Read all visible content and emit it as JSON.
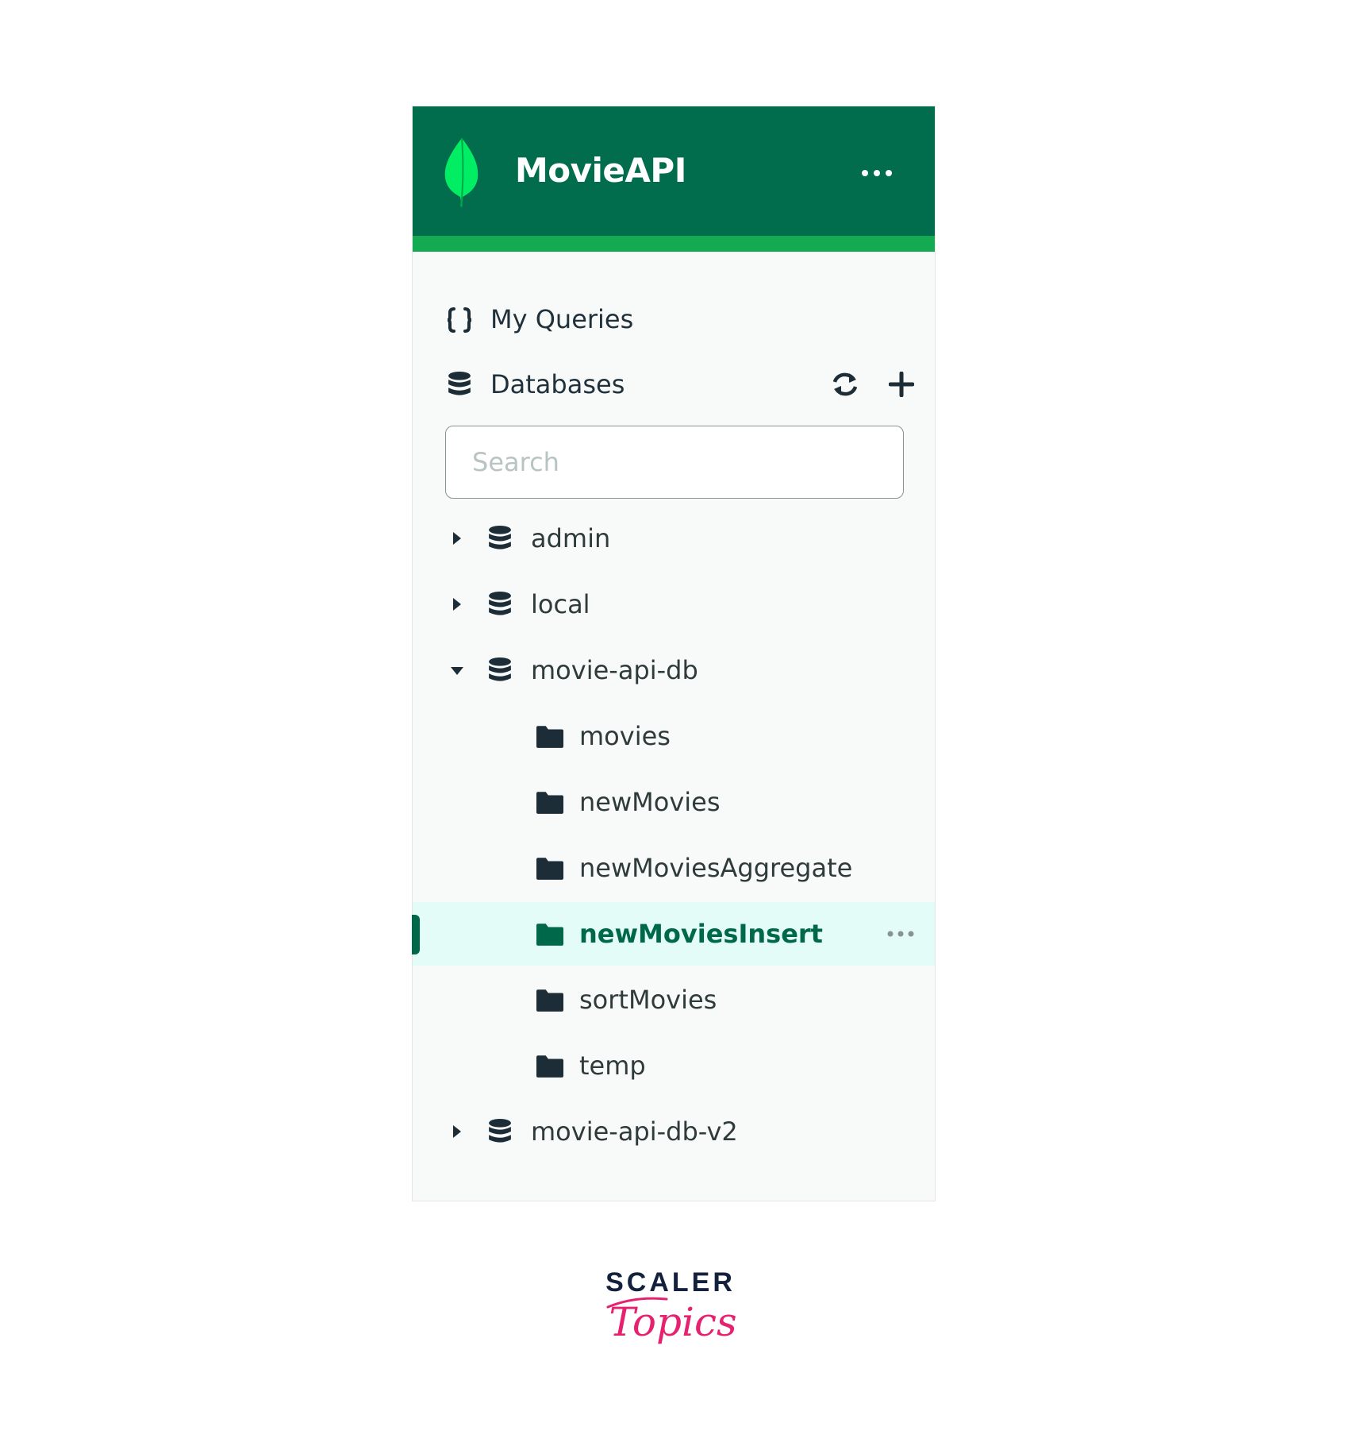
{
  "app": {
    "title": "MovieAPI"
  },
  "nav": {
    "my_queries": "My Queries",
    "databases": "Databases"
  },
  "search": {
    "placeholder": "Search",
    "value": ""
  },
  "tree": {
    "databases": [
      {
        "name": "admin",
        "expanded": false
      },
      {
        "name": "local",
        "expanded": false
      },
      {
        "name": "movie-api-db",
        "expanded": true,
        "collections": [
          {
            "name": "movies",
            "selected": false
          },
          {
            "name": "newMovies",
            "selected": false
          },
          {
            "name": "newMoviesAggregate",
            "selected": false
          },
          {
            "name": "newMoviesInsert",
            "selected": true
          },
          {
            "name": "sortMovies",
            "selected": false
          },
          {
            "name": "temp",
            "selected": false
          }
        ]
      },
      {
        "name": "movie-api-db-v2",
        "expanded": false
      }
    ]
  },
  "icons": {
    "leaf": "mongodb-leaf-icon",
    "queries": "curly-braces-icon",
    "database": "database-icon",
    "collection": "folder-icon",
    "refresh": "refresh-icon",
    "add": "plus-icon",
    "more": "ellipsis-icon",
    "caret_right": "caret-right-icon",
    "caret_down": "caret-down-icon"
  },
  "colors": {
    "header_bg": "#016d4c",
    "header_stripe": "#13aa52",
    "leaf_green": "#00ed64",
    "selected_row_bg": "#e3fcf7",
    "selected_text": "#00684a",
    "panel_bg": "#f8faf9",
    "icon_dark": "#1c2d38",
    "scaler_navy": "#14213d",
    "scaler_pink": "#e6216f"
  },
  "branding": {
    "line1": "SCALER",
    "line2": "Topics"
  }
}
